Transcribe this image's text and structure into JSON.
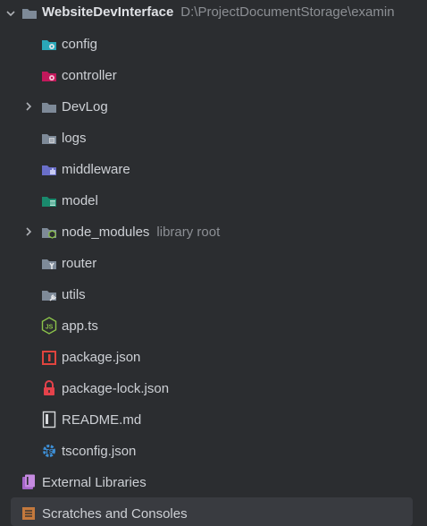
{
  "tree": {
    "root": {
      "name": "WebsiteDevInterface",
      "path": "D:\\ProjectDocumentStorage\\examin"
    },
    "items": [
      {
        "label": "config",
        "icon": "config-folder-icon"
      },
      {
        "label": "controller",
        "icon": "controller-folder-icon"
      },
      {
        "label": "DevLog",
        "icon": "folder-icon"
      },
      {
        "label": "logs",
        "icon": "logs-folder-icon"
      },
      {
        "label": "middleware",
        "icon": "middleware-folder-icon"
      },
      {
        "label": "model",
        "icon": "model-folder-icon"
      },
      {
        "label": "node_modules",
        "hint": "library root",
        "icon": "node-modules-folder-icon"
      },
      {
        "label": "router",
        "icon": "router-folder-icon"
      },
      {
        "label": "utils",
        "icon": "utils-folder-icon"
      },
      {
        "label": "app.ts",
        "icon": "nodejs-file-icon"
      },
      {
        "label": "package.json",
        "icon": "npm-package-icon"
      },
      {
        "label": "package-lock.json",
        "icon": "lock-icon"
      },
      {
        "label": "README.md",
        "icon": "markdown-file-icon"
      },
      {
        "label": "tsconfig.json",
        "icon": "tsconfig-file-icon"
      }
    ],
    "external_libraries": "External Libraries",
    "scratches": "Scratches and Consoles"
  },
  "colors": {
    "background": "#2b2d30",
    "selection": "#393b40",
    "text": "#cdd0d5",
    "muted_text": "#8c8f94",
    "folder": "#7e8a98"
  }
}
